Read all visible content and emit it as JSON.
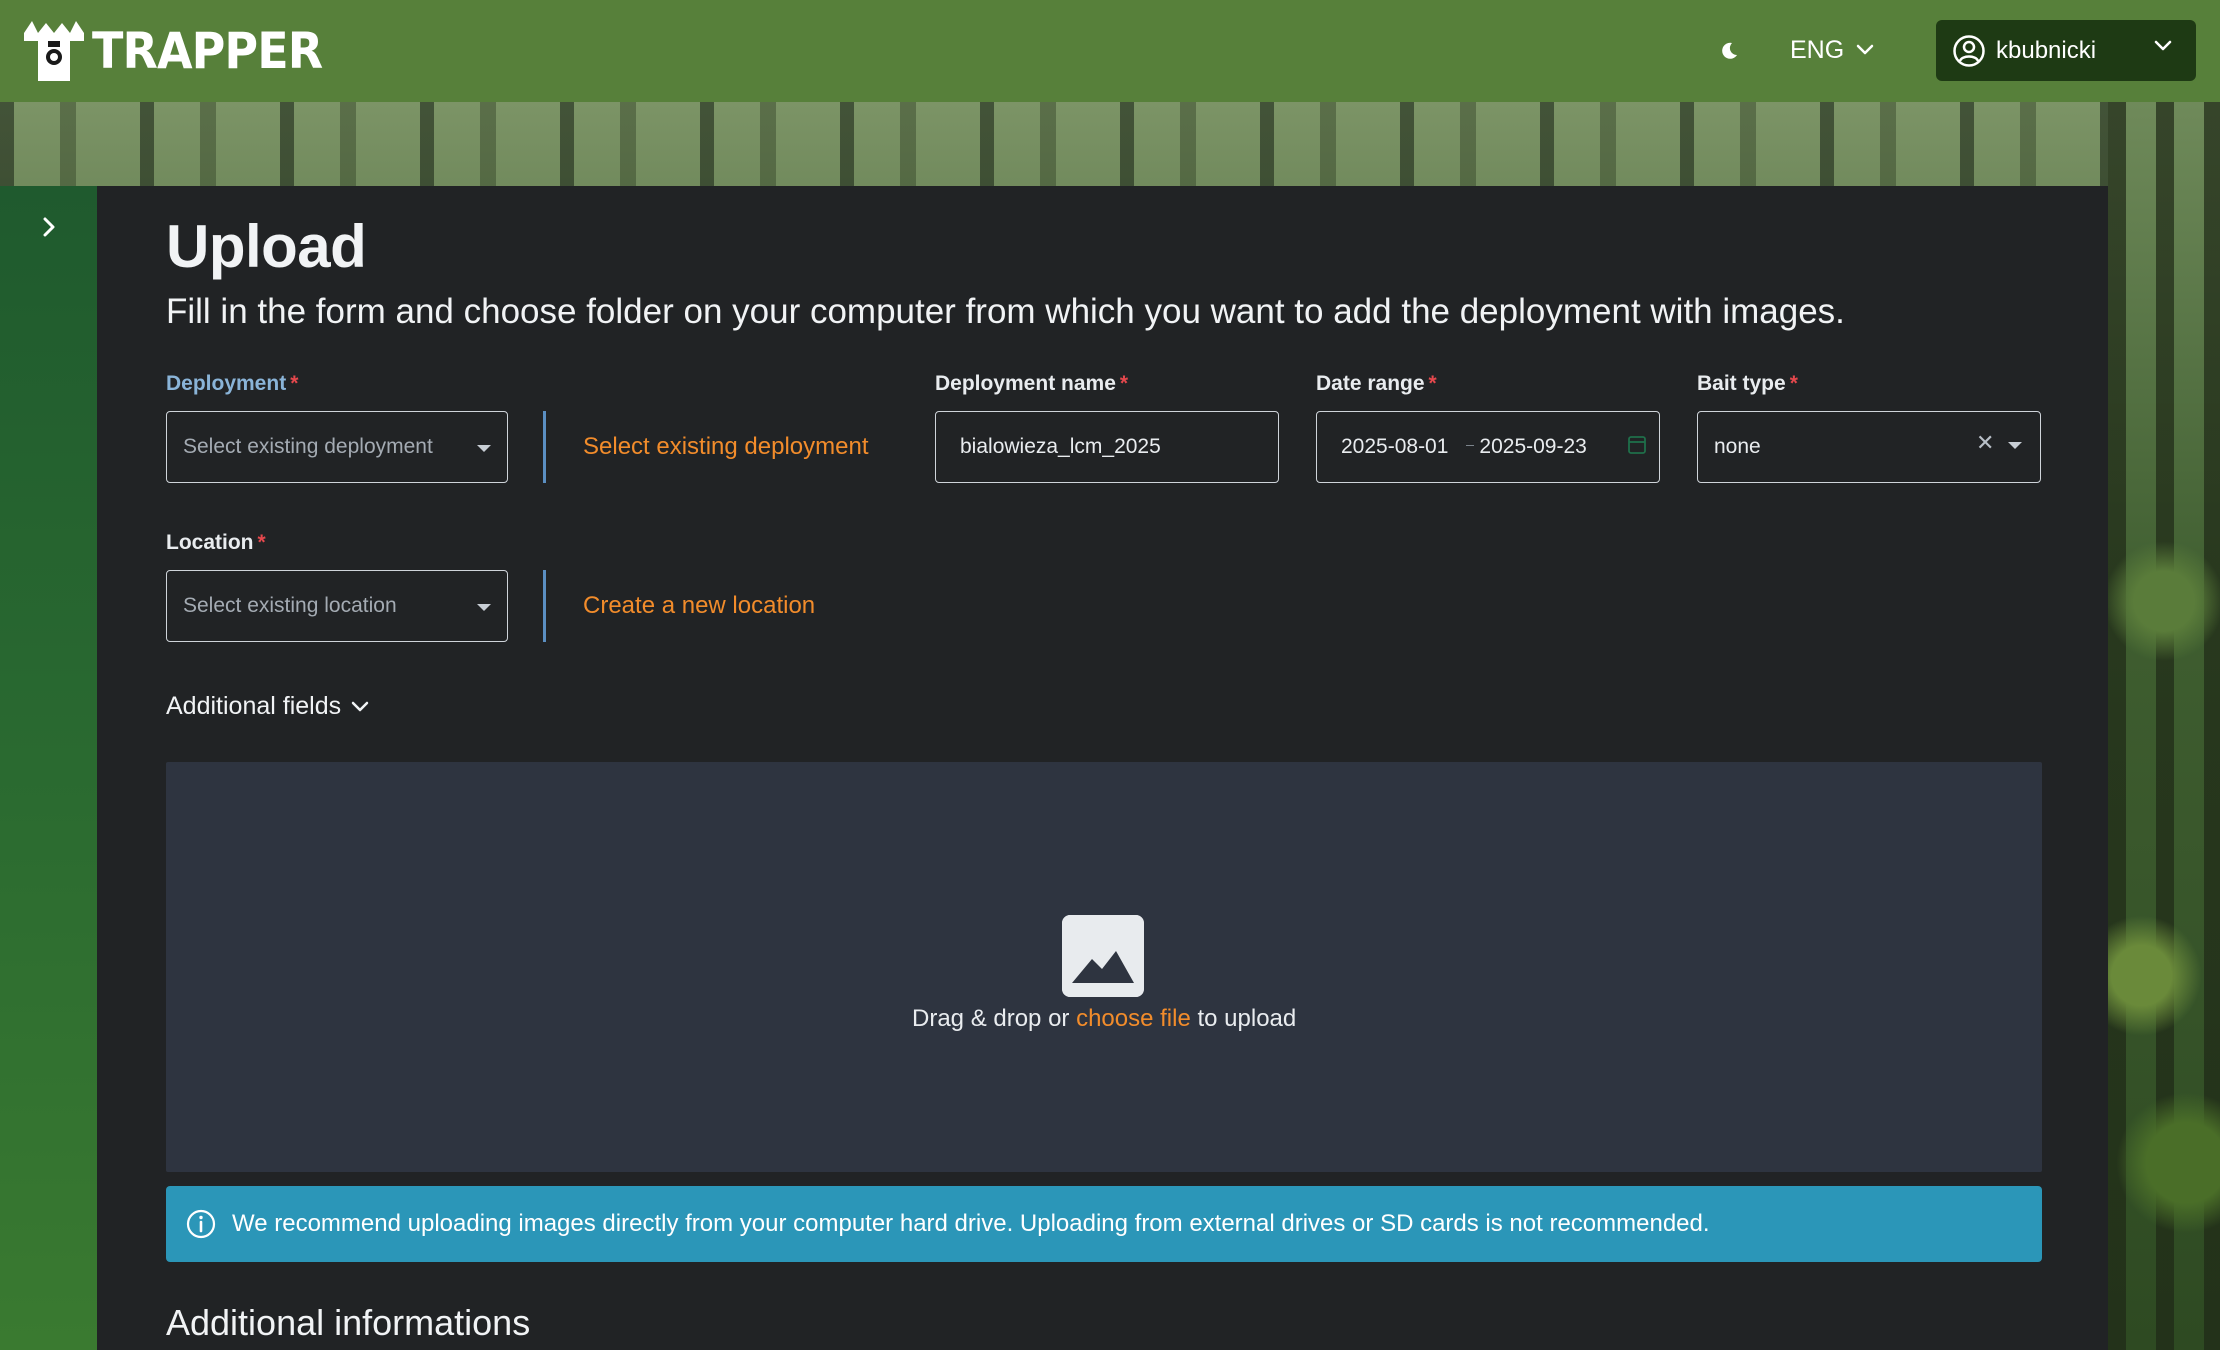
{
  "header": {
    "brand": "TRAPPER",
    "language": "ENG",
    "user": "kbubnicki",
    "colors": {
      "topbar": "#57803a",
      "user_button": "#1e3a14"
    }
  },
  "page": {
    "title": "Upload",
    "subtitle": "Fill in the form and choose folder on your computer from which you want to add the deployment with images."
  },
  "form": {
    "deployment": {
      "label": "Deployment",
      "required_mark": "*",
      "placeholder": "Select existing deployment",
      "alt_link": "Select existing deployment"
    },
    "deployment_name": {
      "label": "Deployment name",
      "required_mark": "*",
      "value": "bialowieza_lcm_2025"
    },
    "date_range": {
      "label": "Date range",
      "required_mark": "*",
      "start": "2025-08-01",
      "end": "2025-09-23"
    },
    "bait_type": {
      "label": "Bait type",
      "required_mark": "*",
      "value": "none"
    },
    "location": {
      "label": "Location",
      "required_mark": "*",
      "placeholder": "Select existing location",
      "alt_link": "Create a new location"
    },
    "additional_fields_label": "Additional fields"
  },
  "dropzone": {
    "prefix": "Drag & drop or ",
    "link": "choose file",
    "suffix": " to upload"
  },
  "alert": {
    "message": "We recommend uploading images directly from your computer hard drive. Uploading from external drives or SD cards is not recommended.",
    "color": "#2b96b8"
  },
  "section": {
    "title": "Additional informations"
  },
  "icons": {
    "theme": "moon-icon",
    "language": "chevron-down-icon",
    "user": "user-circle-icon",
    "sidebar": "chevron-right-icon",
    "dropzone": "image-icon",
    "alert": "info-icon"
  },
  "accent_color": "#f28c2b"
}
